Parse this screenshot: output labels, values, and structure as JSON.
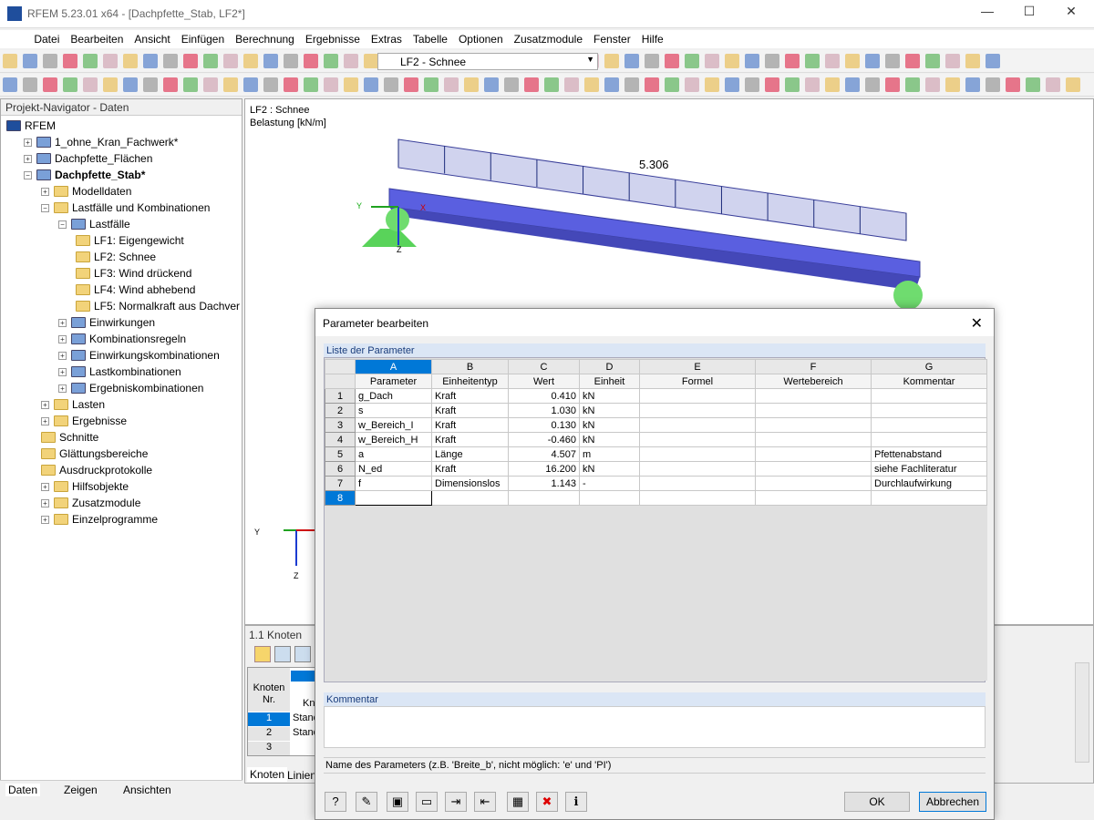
{
  "window": {
    "title": "RFEM 5.23.01 x64 - [Dachpfette_Stab, LF2*]",
    "minimize": "—",
    "maximize": "☐",
    "close": "✕"
  },
  "menu": [
    "Datei",
    "Bearbeiten",
    "Ansicht",
    "Einfügen",
    "Berechnung",
    "Ergebnisse",
    "Extras",
    "Tabelle",
    "Optionen",
    "Zusatzmodule",
    "Fenster",
    "Hilfe"
  ],
  "toolbar": {
    "loadcase_select": "LF2 - Schnee"
  },
  "navigator": {
    "title": "Projekt-Navigator - Daten",
    "items": [
      {
        "label": "RFEM",
        "level": 0,
        "icon": "rfem-icon",
        "bold": false
      },
      {
        "label": "1_ohne_Kran_Fachwerk*",
        "level": 1,
        "icon": "model-icon",
        "exp": "+"
      },
      {
        "label": "Dachpfette_Flächen",
        "level": 1,
        "icon": "model-icon",
        "exp": "+"
      },
      {
        "label": "Dachpfette_Stab*",
        "level": 1,
        "icon": "model-icon",
        "exp": "-",
        "bold": true
      },
      {
        "label": "Modelldaten",
        "level": 2,
        "icon": "folder-icon",
        "exp": "+"
      },
      {
        "label": "Lastfälle und Kombinationen",
        "level": 2,
        "icon": "folder-icon",
        "exp": "-"
      },
      {
        "label": "Lastfälle",
        "level": 3,
        "icon": "loadcases-icon",
        "exp": "-"
      },
      {
        "label": "LF1: Eigengewicht",
        "level": 4,
        "icon": "folder-icon"
      },
      {
        "label": "LF2: Schnee",
        "level": 4,
        "icon": "folder-icon"
      },
      {
        "label": "LF3: Wind drückend",
        "level": 4,
        "icon": "folder-icon"
      },
      {
        "label": "LF4: Wind abhebend",
        "level": 4,
        "icon": "folder-icon"
      },
      {
        "label": "LF5: Normalkraft aus Dachver",
        "level": 4,
        "icon": "folder-icon"
      },
      {
        "label": "Einwirkungen",
        "level": 3,
        "icon": "actions-icon",
        "exp": "+"
      },
      {
        "label": "Kombinationsregeln",
        "level": 3,
        "icon": "rules-icon",
        "exp": "+"
      },
      {
        "label": "Einwirkungskombinationen",
        "level": 3,
        "icon": "combos-icon",
        "exp": "+"
      },
      {
        "label": "Lastkombinationen",
        "level": 3,
        "icon": "combos-icon",
        "exp": "+"
      },
      {
        "label": "Ergebniskombinationen",
        "level": 3,
        "icon": "combos-icon",
        "exp": "+"
      },
      {
        "label": "Lasten",
        "level": 2,
        "icon": "folder-icon",
        "exp": "+"
      },
      {
        "label": "Ergebnisse",
        "level": 2,
        "icon": "folder-icon",
        "exp": "+"
      },
      {
        "label": "Schnitte",
        "level": 2,
        "icon": "folder-icon"
      },
      {
        "label": "Glättungsbereiche",
        "level": 2,
        "icon": "folder-icon"
      },
      {
        "label": "Ausdruckprotokolle",
        "level": 2,
        "icon": "folder-icon"
      },
      {
        "label": "Hilfsobjekte",
        "level": 2,
        "icon": "folder-icon",
        "exp": "+"
      },
      {
        "label": "Zusatzmodule",
        "level": 2,
        "icon": "folder-icon",
        "exp": "+"
      },
      {
        "label": "Einzelprogramme",
        "level": 2,
        "icon": "folder-icon",
        "exp": "+"
      }
    ],
    "tabs": [
      "Daten",
      "Zeigen",
      "Ansichten"
    ]
  },
  "graphic": {
    "line1": "LF2 : Schnee",
    "line2": "Belastung [kN/m]",
    "load_value": "5.306",
    "axis_x": "X",
    "axis_y": "Y",
    "axis_z": "Z"
  },
  "bottom_panel": {
    "title": "1.1 Knoten",
    "col_header1": "Knoten",
    "col_header2": "Nr.",
    "col_header3": "Kn",
    "rows": [
      {
        "nr": "1",
        "v": "Stand"
      },
      {
        "nr": "2",
        "v": "Stand"
      },
      {
        "nr": "3",
        "v": ""
      }
    ],
    "tabs": [
      "Knoten",
      "Linien"
    ]
  },
  "dialog": {
    "title": "Parameter bearbeiten",
    "group_title": "Liste der Parameter",
    "col_letters": [
      "A",
      "B",
      "C",
      "D",
      "E",
      "F",
      "G"
    ],
    "col_headers": [
      "Parameter",
      "Einheitentyp",
      "Wert",
      "Einheit",
      "Formel",
      "Wertebereich",
      "Kommentar"
    ],
    "rows": [
      [
        "1",
        "g_Dach",
        "Kraft",
        "0.410",
        "kN",
        "",
        "",
        ""
      ],
      [
        "2",
        "s",
        "Kraft",
        "1.030",
        "kN",
        "",
        "",
        ""
      ],
      [
        "3",
        "w_Bereich_I",
        "Kraft",
        "0.130",
        "kN",
        "",
        "",
        ""
      ],
      [
        "4",
        "w_Bereich_H",
        "Kraft",
        "-0.460",
        "kN",
        "",
        "",
        ""
      ],
      [
        "5",
        "a",
        "Länge",
        "4.507",
        "m",
        "",
        "",
        "Pfettenabstand"
      ],
      [
        "6",
        "N_ed",
        "Kraft",
        "16.200",
        "kN",
        "",
        "",
        "siehe Fachliteratur"
      ],
      [
        "7",
        "f",
        "Dimensionslos",
        "1.143",
        "-",
        "",
        "",
        "Durchlaufwirkung"
      ],
      [
        "8",
        "",
        "",
        "",
        "",
        "",
        "",
        ""
      ]
    ],
    "comment_title": "Kommentar",
    "hint": "Name des Parameters (z.B. 'Breite_b', nicht möglich: 'e' und 'PI')",
    "ok": "OK",
    "cancel": "Abbrechen"
  }
}
